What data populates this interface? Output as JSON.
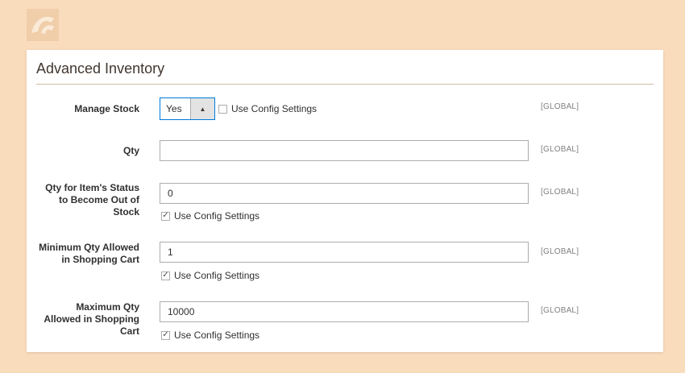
{
  "panel": {
    "title": "Advanced Inventory"
  },
  "fields": {
    "manage_stock": {
      "label": "Manage Stock",
      "selected": "Yes",
      "use_config_label": "Use Config Settings",
      "use_config_checked": false,
      "scope": "[GLOBAL]"
    },
    "qty": {
      "label": "Qty",
      "value": "",
      "scope": "[GLOBAL]"
    },
    "out_of_stock": {
      "label_line1": "Qty for Item's Status",
      "label_line2": "to Become Out of",
      "label_line3": "Stock",
      "value": "0",
      "use_config_label": "Use Config Settings",
      "use_config_checked": true,
      "scope": "[GLOBAL]"
    },
    "min_qty": {
      "label_line1": "Minimum Qty Allowed",
      "label_line2": "in Shopping Cart",
      "value": "1",
      "use_config_label": "Use Config Settings",
      "use_config_checked": true,
      "scope": "[GLOBAL]"
    },
    "max_qty": {
      "label_line1": "Maximum Qty",
      "label_line2": "Allowed in Shopping",
      "label_line3": "Cart",
      "value": "10000",
      "use_config_label": "Use Config Settings",
      "use_config_checked": true,
      "scope": "[GLOBAL]"
    }
  },
  "icons": {
    "logo": "brand-logo-icon",
    "select_arrow": "caret-up-icon",
    "checkmark": "checkmark-icon"
  },
  "colors": {
    "background": "#f9dcbc",
    "focus_border": "#007bdb",
    "title_rule": "#cdbda4"
  }
}
